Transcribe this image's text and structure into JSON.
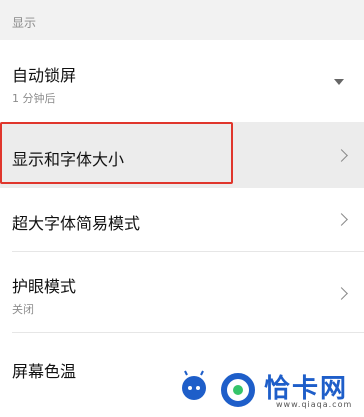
{
  "section": {
    "title": "显示"
  },
  "rows": [
    {
      "title": "自动锁屏",
      "subtitle": "1 分钟后",
      "control": "dropdown-triangle"
    },
    {
      "title": "显示和字体大小",
      "control": "chevron-right",
      "highlighted": true
    },
    {
      "title": "超大字体简易模式",
      "control": "chevron-right"
    },
    {
      "title": "护眼模式",
      "subtitle": "关闭",
      "control": "chevron-right"
    },
    {
      "title": "屏幕色温"
    }
  ],
  "watermark": {
    "brand": "恰卡网",
    "url": "www.qiaqa.com",
    "colors": {
      "blue": "#1e5ec9",
      "green": "#35c46a"
    }
  },
  "colors": {
    "highlight_border": "#e0362c",
    "section_bg": "#f2f2f2",
    "row_highlight_bg": "#ececec"
  }
}
